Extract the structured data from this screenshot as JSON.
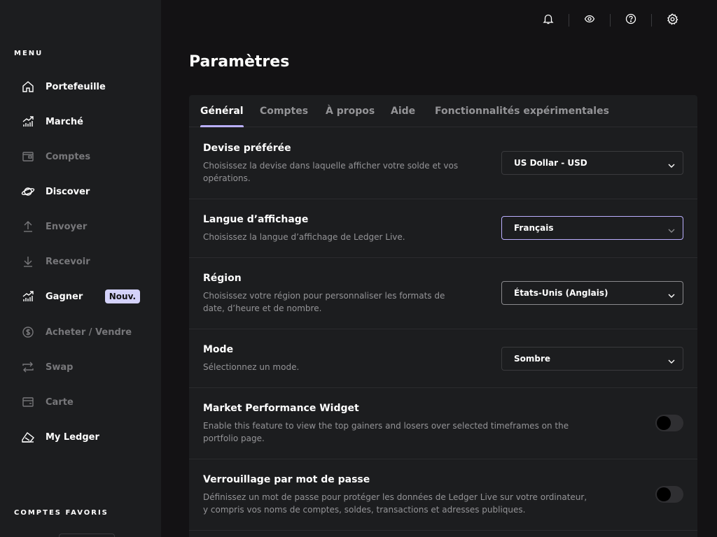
{
  "sidebar": {
    "menu_heading": "MENU",
    "items": [
      {
        "label": "Portefeuille"
      },
      {
        "label": "Marché"
      },
      {
        "label": "Comptes"
      },
      {
        "label": "Discover"
      },
      {
        "label": "Envoyer"
      },
      {
        "label": "Recevoir"
      },
      {
        "label": "Gagner",
        "badge": "Nouv."
      },
      {
        "label": "Acheter / Vendre"
      },
      {
        "label": "Swap"
      },
      {
        "label": "Carte"
      },
      {
        "label": "My Ledger"
      }
    ],
    "favorites_heading": "COMPTES FAVORIS"
  },
  "topbar": {
    "icons": [
      "bell-icon",
      "eye-icon",
      "help-icon",
      "gear-icon"
    ]
  },
  "page": {
    "title": "Paramètres"
  },
  "tabs": [
    {
      "label": "Général",
      "active": true
    },
    {
      "label": "Comptes"
    },
    {
      "label": "À propos"
    },
    {
      "label": "Aide"
    },
    {
      "label": "Fonctionnalités expérimentales"
    }
  ],
  "settings": {
    "currency": {
      "title": "Devise préférée",
      "desc_line1": "Choisissez la devise dans laquelle afficher votre solde et vos",
      "desc_line2": "opérations.",
      "value": "US Dollar - USD"
    },
    "language": {
      "title": "Langue d’affichage",
      "desc": "Choisissez la langue d’affichage de Ledger Live.",
      "value": "Français"
    },
    "region": {
      "title": "Région",
      "desc_line1": "Choisissez votre région pour personnaliser les formats de",
      "desc_line2": "date, d’heure et de nombre.",
      "value": "États-Unis (Anglais)"
    },
    "mode": {
      "title": "Mode",
      "desc": "Sélectionnez un mode.",
      "value": "Sombre"
    },
    "market_widget": {
      "title": "Market Performance Widget",
      "desc_line1": "Enable this feature to view the top gainers and losers over selected timeframes on the",
      "desc_line2": "portfolio page.",
      "enabled": false
    },
    "password_lock": {
      "title": "Verrouillage par mot de passe",
      "desc_line1": "Définissez un mot de passe pour protéger les données de Ledger Live sur votre ordinateur,",
      "desc_line2": "y compris vos noms de comptes, soldes, transactions et adresses publiques.",
      "enabled": false
    }
  },
  "colors": {
    "accent": "#bbb0ff",
    "badge_bg": "#d4d2fa",
    "sidebar_bg": "#1c1d1f",
    "page_bg": "#131214",
    "muted_text": "#949497"
  }
}
